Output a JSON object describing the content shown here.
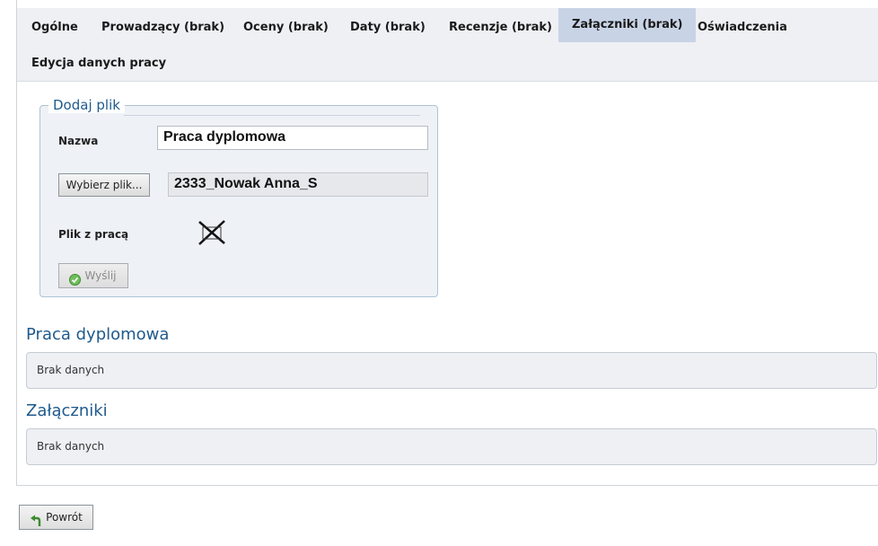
{
  "tabs": [
    {
      "label": "Ogólne"
    },
    {
      "label": "Prowadzący (brak)"
    },
    {
      "label": "Oceny (brak)"
    },
    {
      "label": "Daty (brak)"
    },
    {
      "label": "Recenzje (brak)"
    },
    {
      "label": "Załączniki (brak)",
      "active": true
    },
    {
      "label": "Oświadczenia"
    },
    {
      "label": "Edycja danych pracy"
    }
  ],
  "add_file": {
    "legend": "Dodaj plik",
    "name_label": "Nazwa",
    "name_value": "Praca dyplomowa",
    "choose_button": "Wybierz plik...",
    "file_value": "2333_Nowak Anna_S",
    "thesis_file_label": "Plik z pracą",
    "thesis_file_icon": "cross-icon",
    "send_button": "Wyślij"
  },
  "sections": [
    {
      "title": "Praca dyplomowa",
      "content": "Brak danych"
    },
    {
      "title": "Załączniki",
      "content": "Brak danych"
    }
  ],
  "back_button": "Powrót",
  "colors": {
    "accent": "#1f5a8c",
    "active_tab": "#c8d4e6",
    "box_bg": "#eef0f4"
  }
}
